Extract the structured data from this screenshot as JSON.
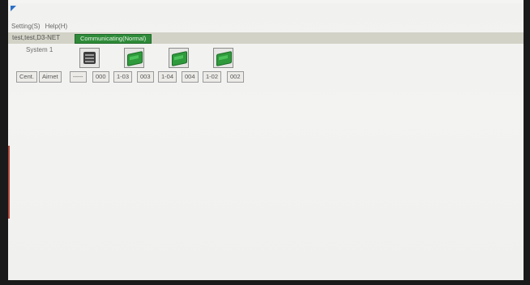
{
  "menu": {
    "setting": "Setting(S)",
    "help": "Help(H)"
  },
  "connection": {
    "name": "test,test,D3-NET",
    "status": "Communicating(Normal)"
  },
  "system": {
    "label": "System 1"
  },
  "buttons": {
    "cent": "Cent.",
    "airnet": "Airnet"
  },
  "units": [
    {
      "icon": "controller-icon",
      "addr": "-----",
      "id": "000"
    },
    {
      "icon": "indoor-unit-icon",
      "addr": "1-03",
      "id": "003",
      "color": "#2f9a3c"
    },
    {
      "icon": "indoor-unit-icon",
      "addr": "1-04",
      "id": "004",
      "color": "#2f9a3c"
    },
    {
      "icon": "indoor-unit-icon",
      "addr": "1-02",
      "id": "002",
      "color": "#2f9a3c"
    }
  ],
  "colors": {
    "status_green": "#2e8a38",
    "status_bar": "#d3d2c6"
  }
}
